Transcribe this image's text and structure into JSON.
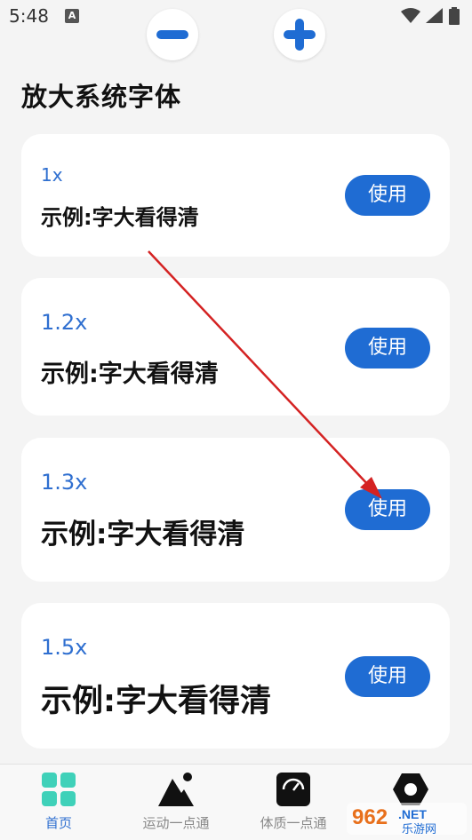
{
  "status_bar": {
    "time": "5:48",
    "notification_letter": "A",
    "icons": [
      "wifi-icon",
      "signal-icon",
      "battery-icon"
    ]
  },
  "toolbar": {
    "decrease_icon": "minus-icon",
    "increase_icon": "plus-icon"
  },
  "page": {
    "title": "放大系统字体",
    "accent_color": "#1f6cd3"
  },
  "font_options": [
    {
      "scale": "1x",
      "example": "示例:字大看得清",
      "button": "使用"
    },
    {
      "scale": "1.2x",
      "example": "示例:字大看得清",
      "button": "使用"
    },
    {
      "scale": "1.3x",
      "example": "示例:字大看得清",
      "button": "使用"
    },
    {
      "scale": "1.5x",
      "example": "示例:字大看得清",
      "button": "使用"
    }
  ],
  "tab_bar": {
    "tabs": [
      {
        "label": "首页",
        "icon": "grid-icon",
        "active": true
      },
      {
        "label": "运动一点通",
        "icon": "mountain-icon",
        "active": false
      },
      {
        "label": "体质一点通",
        "icon": "scale-gauge-icon",
        "active": false
      },
      {
        "label": "",
        "icon": "gear-icon",
        "active": false
      }
    ]
  },
  "watermark": {
    "number": "962",
    "suffix": ".NET",
    "name": "乐游网"
  }
}
